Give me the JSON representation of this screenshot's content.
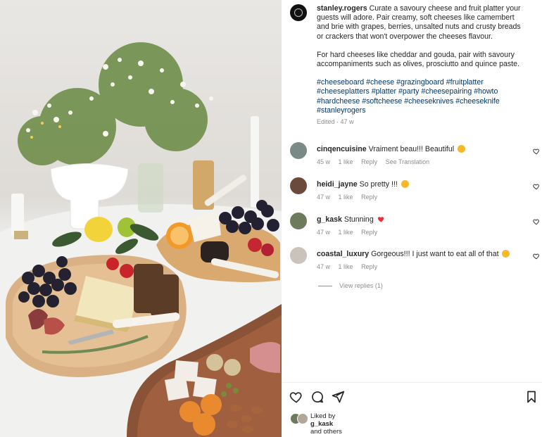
{
  "post": {
    "username": "stanley.rogers",
    "caption_p1": "Curate a savoury cheese and fruit platter your guests will adore. Pair creamy, soft cheeses like camembert and brie with grapes, berries, unsalted nuts and crusty breads or crackers that won't overpower the cheeses flavour.",
    "caption_p2": "For hard cheeses like cheddar and gouda, pair with savoury accompaniments such as olives, prosciutto and quince paste.",
    "hashtags": "#cheeseboard #cheese #grazingboard #fruitplatter #cheeseplatters #platter #party #cheesepairing #howto #hardcheese #softcheese #cheeseknives #cheeseknife #stanleyrogers",
    "edited": "Edited · 47 w"
  },
  "comments": [
    {
      "username": "cinqencuisine",
      "text": "Vraiment beau!!! Beautiful",
      "emoji_icon": "star-struck-emoji",
      "age": "45 w",
      "likes": "1 like",
      "reply": "Reply",
      "translate": "See Translation",
      "avatar_color": "#7a8a86"
    },
    {
      "username": "heidi_jayne",
      "text": "So pretty !!!",
      "emoji_icon": "raising-hands-emoji",
      "age": "47 w",
      "likes": "1 like",
      "reply": "Reply",
      "avatar_color": "#6b4a3e"
    },
    {
      "username": "g_kask",
      "text": "Stunning",
      "emoji_icon": "red-heart-emoji",
      "age": "47 w",
      "likes": "1 like",
      "reply": "Reply",
      "avatar_color": "#6d7a5c"
    },
    {
      "username": "coastal_luxury",
      "text": "Gorgeous!!! I just want to eat all of that",
      "emoji_icon": "heart-eyes-emoji",
      "age": "47 w",
      "likes": "1 like",
      "reply": "Reply",
      "avatar_color": "#c9c3bb"
    }
  ],
  "view_replies": "View replies (1)",
  "actions": [
    "heart-icon",
    "comment-icon",
    "share-icon",
    "bookmark-icon"
  ],
  "liked_by": {
    "prefix": "Liked by",
    "user": "g_kask",
    "suffix": "and others"
  },
  "colors": {
    "link": "#00376b",
    "muted": "#8e8e8e",
    "heart": "#ed4956",
    "emoji": "#f7b928"
  }
}
